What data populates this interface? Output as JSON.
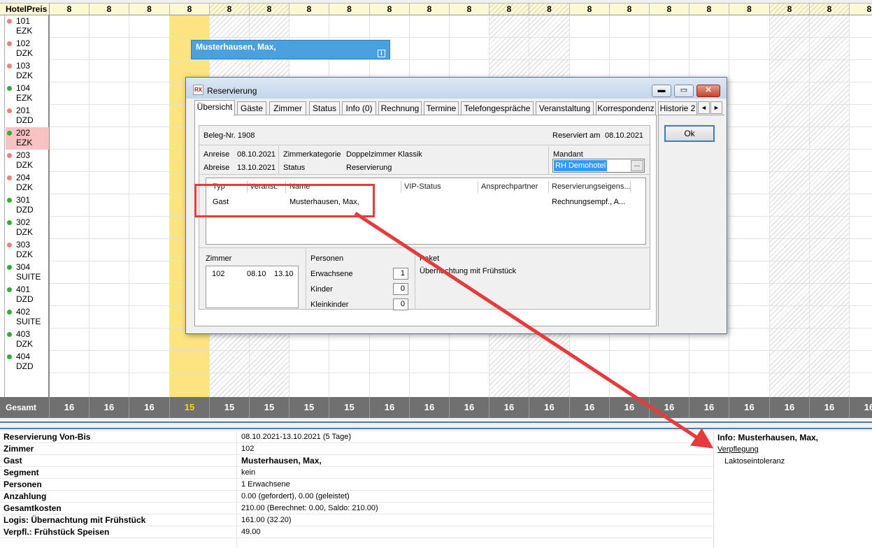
{
  "planner": {
    "header_label": "HotelPreis",
    "columns": [
      {
        "price": "8",
        "total": "16",
        "style": ""
      },
      {
        "price": "8",
        "total": "16",
        "style": ""
      },
      {
        "price": "8",
        "total": "16",
        "style": ""
      },
      {
        "price": "8",
        "total": "15",
        "style": "today"
      },
      {
        "price": "8",
        "total": "15",
        "style": "hatch"
      },
      {
        "price": "8",
        "total": "15",
        "style": "hatch"
      },
      {
        "price": "8",
        "total": "15",
        "style": ""
      },
      {
        "price": "8",
        "total": "15",
        "style": ""
      },
      {
        "price": "8",
        "total": "16",
        "style": ""
      },
      {
        "price": "8",
        "total": "16",
        "style": ""
      },
      {
        "price": "8",
        "total": "16",
        "style": ""
      },
      {
        "price": "8",
        "total": "16",
        "style": "hatch"
      },
      {
        "price": "8",
        "total": "16",
        "style": "hatch"
      },
      {
        "price": "8",
        "total": "16",
        "style": ""
      },
      {
        "price": "8",
        "total": "16",
        "style": ""
      },
      {
        "price": "8",
        "total": "16",
        "style": ""
      },
      {
        "price": "8",
        "total": "16",
        "style": ""
      },
      {
        "price": "8",
        "total": "16",
        "style": ""
      },
      {
        "price": "8",
        "total": "16",
        "style": "hatch"
      },
      {
        "price": "8",
        "total": "16",
        "style": "hatch"
      },
      {
        "price": "8",
        "total": "16",
        "style": ""
      }
    ],
    "rooms": [
      {
        "number": "101",
        "category": "EZK",
        "status": "red",
        "selected": false
      },
      {
        "number": "102",
        "category": "DZK",
        "status": "red",
        "selected": false
      },
      {
        "number": "103",
        "category": "DZK",
        "status": "red",
        "selected": false
      },
      {
        "number": "104",
        "category": "EZK",
        "status": "green",
        "selected": false
      },
      {
        "number": "201",
        "category": "DZD",
        "status": "red",
        "selected": false
      },
      {
        "number": "202",
        "category": "EZK",
        "status": "green",
        "selected": true
      },
      {
        "number": "203",
        "category": "DZK",
        "status": "red",
        "selected": false
      },
      {
        "number": "204",
        "category": "DZK",
        "status": "red",
        "selected": false
      },
      {
        "number": "301",
        "category": "DZD",
        "status": "green",
        "selected": false
      },
      {
        "number": "302",
        "category": "DZK",
        "status": "green",
        "selected": false
      },
      {
        "number": "303",
        "category": "DZK",
        "status": "red",
        "selected": false
      },
      {
        "number": "304",
        "category": "SUITE",
        "status": "green",
        "selected": false
      },
      {
        "number": "401",
        "category": "DZD",
        "status": "green",
        "selected": false
      },
      {
        "number": "402",
        "category": "SUITE",
        "status": "green",
        "selected": false
      },
      {
        "number": "403",
        "category": "DZK",
        "status": "green",
        "selected": false
      },
      {
        "number": "404",
        "category": "DZD",
        "status": "green",
        "selected": false
      }
    ],
    "total_label": "Gesamt",
    "reservation_bar": {
      "guest": "Musterhausen, Max,",
      "icon": "i"
    }
  },
  "colors": {
    "status_red": "#f08080",
    "status_green": "#3aa83a",
    "reservation_bar": "#4aa1dd",
    "today_column": "#fde481",
    "annotation": "#e8393b"
  },
  "dialog": {
    "title": "Reservierung",
    "app_icon": "RX",
    "window_buttons": {
      "minimize": "▬",
      "maximize": "▭",
      "close": "✕"
    },
    "tabs": [
      "Übersicht",
      "Gäste",
      "Zimmer",
      "Status",
      "Info (0)",
      "Rechnung",
      "Termine",
      "Telefongespräche",
      "Veranstaltung",
      "Korrespondenz",
      "Historie 2"
    ],
    "tab_scroll": {
      "left": "◄",
      "right": "►"
    },
    "ok_label": "Ok",
    "beleg": "Beleg-Nr. 1908",
    "reserviert_label": "Reserviert am",
    "reserviert_date": "08.10.2021",
    "anreise_label": "Anreise",
    "anreise": "08.10.2021",
    "abreise_label": "Abreise",
    "abreise": "13.10.2021",
    "zimmerkategorie_label": "Zimmerkategorie",
    "zimmerkategorie": "Doppelzimmer Klassik",
    "status_label": "Status",
    "status": "Reservierung",
    "mandant_label": "Mandant",
    "mandant_value": "RH Demohotel",
    "mandant_button": "...",
    "guest_columns": [
      "Typ",
      "Veranst.",
      "Name",
      "VIP-Status",
      "Ansprechpartner",
      "Reservierungseigens..."
    ],
    "guest_row": {
      "typ": "Gast",
      "name": "Musterhausen, Max,",
      "eigenschaften": "Rechnungsempf., A..."
    },
    "zimmer_label": "Zimmer",
    "zimmer_row": {
      "room": "102",
      "from": "08.10",
      "to": "13.10"
    },
    "personen_label": "Personen",
    "erwachsene_label": "Erwachsene",
    "erwachsene": "1",
    "kinder_label": "Kinder",
    "kinder": "0",
    "kleinkinder_label": "Kleinkinder",
    "kleinkinder": "0",
    "paket_label": "Paket",
    "paket_value": "Übernachtung mit Frühstück"
  },
  "info": {
    "rows": [
      {
        "label": "Reservierung Von-Bis",
        "value": "08.10.2021-13.10.2021 (5 Tage)",
        "bold": false
      },
      {
        "label": "Zimmer",
        "value": "102",
        "bold": false
      },
      {
        "label": "Gast",
        "value": "Musterhausen, Max,",
        "bold": true
      },
      {
        "label": "Segment",
        "value": "kein",
        "bold": false
      },
      {
        "label": "Personen",
        "value": "1 Erwachsene",
        "bold": false
      },
      {
        "label": "Anzahlung",
        "value": "0.00 (gefordert), 0.00 (geleistet)",
        "bold": false
      },
      {
        "label": "Gesamtkosten",
        "value": "210.00 (Berechnet: 0.00, Saldo: 210.00)",
        "bold": false
      },
      {
        "label": "Logis: Übernachtung mit Frühstück",
        "value": "161.00 (32.20)",
        "bold": false
      },
      {
        "label": "Verpfl.: Frühstück Speisen",
        "value": "49.00",
        "bold": false
      }
    ],
    "right_title": "Info: Musterhausen, Max,",
    "right_link": "Verpflegung",
    "right_text": "Laktoseintoleranz"
  }
}
